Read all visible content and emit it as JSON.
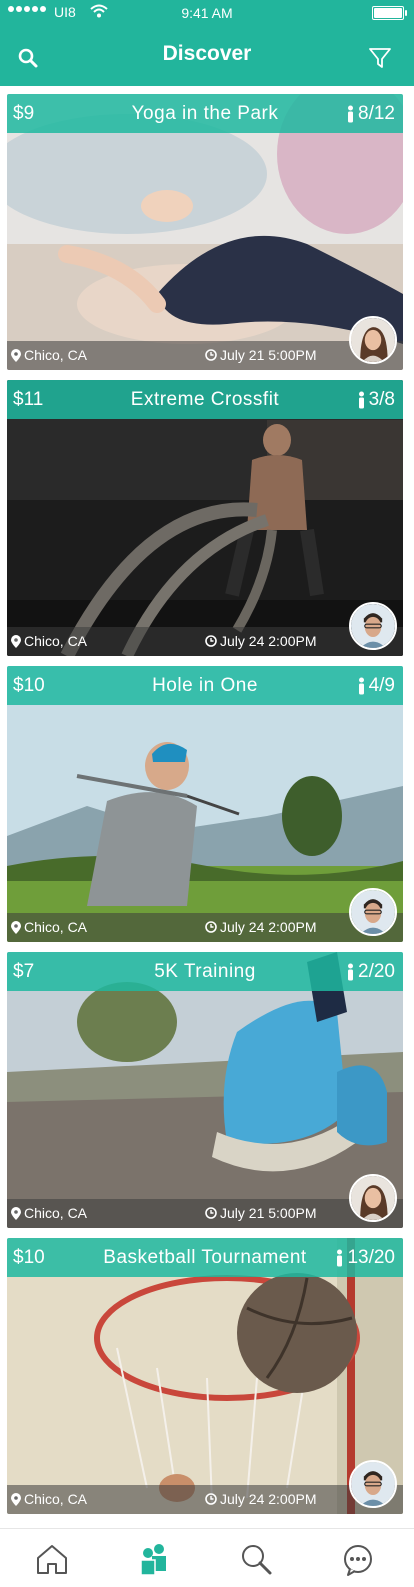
{
  "status_bar": {
    "carrier": "UI8",
    "time": "9:41 AM"
  },
  "header": {
    "title": "Discover",
    "left_icon": "search-icon",
    "right_icon": "filter-icon"
  },
  "events": [
    {
      "price": "$9",
      "title": "Yoga in the Park",
      "attendance": "8/12",
      "location": "Chico, CA",
      "datetime": "July 21 5:00PM"
    },
    {
      "price": "$11",
      "title": "Extreme Crossfit",
      "attendance": "3/8",
      "location": "Chico, CA",
      "datetime": "July 24 2:00PM"
    },
    {
      "price": "$10",
      "title": "Hole in One",
      "attendance": "4/9",
      "location": "Chico, CA",
      "datetime": "July 24 2:00PM"
    },
    {
      "price": "$7",
      "title": "5K Training",
      "attendance": "2/20",
      "location": "Chico, CA",
      "datetime": "July 21 5:00PM"
    },
    {
      "price": "$10",
      "title": "Basketball Tournament",
      "attendance": "13/20",
      "location": "Chico, CA",
      "datetime": "July 24 2:00PM"
    }
  ],
  "tabbar": {
    "items": [
      {
        "icon": "home-icon",
        "active": false
      },
      {
        "icon": "people-icon",
        "active": true
      },
      {
        "icon": "search-icon",
        "active": false
      },
      {
        "icon": "chat-icon",
        "active": false
      }
    ]
  },
  "colors": {
    "accent": "#22b59c",
    "tab_inactive": "#555555"
  }
}
